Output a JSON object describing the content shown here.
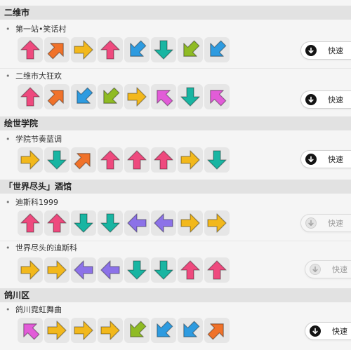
{
  "colors": {
    "pink": "#ee4a7e",
    "orange": "#f0722a",
    "yellow": "#f2b81c",
    "blue": "#2e9be0",
    "teal": "#19b5a2",
    "green": "#8fbb24",
    "purple": "#8c72e8",
    "magenta": "#e25cd8"
  },
  "sections": [
    {
      "title": "二维市",
      "songs": [
        {
          "title": "第一站•笑话村",
          "button": {
            "label": "快速",
            "icon": "down-arrow-icon",
            "enabled": true
          },
          "arrows": [
            {
              "dir": "up",
              "color": "pink"
            },
            {
              "dir": "up-right",
              "color": "orange"
            },
            {
              "dir": "right",
              "color": "yellow"
            },
            {
              "dir": "up",
              "color": "pink"
            },
            {
              "dir": "down-left",
              "color": "blue"
            },
            {
              "dir": "down",
              "color": "teal"
            },
            {
              "dir": "down-left",
              "color": "green"
            },
            {
              "dir": "down-left",
              "color": "blue"
            }
          ]
        },
        {
          "title": "二维市大狂欢",
          "button": {
            "label": "快速",
            "icon": "down-arrow-icon",
            "enabled": true
          },
          "arrows": [
            {
              "dir": "up",
              "color": "pink"
            },
            {
              "dir": "up-right",
              "color": "orange"
            },
            {
              "dir": "down-left",
              "color": "blue"
            },
            {
              "dir": "down-left",
              "color": "green"
            },
            {
              "dir": "right",
              "color": "yellow"
            },
            {
              "dir": "up-left",
              "color": "magenta"
            },
            {
              "dir": "down",
              "color": "teal"
            },
            {
              "dir": "up-left",
              "color": "magenta"
            }
          ]
        }
      ]
    },
    {
      "title": "绘世学院",
      "songs": [
        {
          "title": "学院节奏蓝调",
          "button": {
            "label": "快速",
            "icon": "down-arrow-icon",
            "enabled": true
          },
          "arrows": [
            {
              "dir": "right",
              "color": "yellow"
            },
            {
              "dir": "down",
              "color": "teal"
            },
            {
              "dir": "up-right",
              "color": "orange"
            },
            {
              "dir": "up",
              "color": "pink"
            },
            {
              "dir": "up",
              "color": "pink"
            },
            {
              "dir": "up",
              "color": "pink"
            },
            {
              "dir": "right",
              "color": "yellow"
            },
            {
              "dir": "down",
              "color": "teal"
            }
          ]
        }
      ]
    },
    {
      "title": "「世界尽头」酒馆",
      "songs": [
        {
          "title": "迪斯科1999",
          "button": {
            "label": "快速",
            "icon": "down-arrow-icon",
            "enabled": false
          },
          "arrows": [
            {
              "dir": "up",
              "color": "pink"
            },
            {
              "dir": "up",
              "color": "pink"
            },
            {
              "dir": "down",
              "color": "teal"
            },
            {
              "dir": "down",
              "color": "teal"
            },
            {
              "dir": "left",
              "color": "purple"
            },
            {
              "dir": "left",
              "color": "purple"
            },
            {
              "dir": "right",
              "color": "yellow"
            },
            {
              "dir": "right",
              "color": "yellow"
            }
          ]
        },
        {
          "title": "世界尽头的迪斯科",
          "button": {
            "label": "快速",
            "icon": "down-arrow-icon",
            "enabled": false
          },
          "arrows": [
            {
              "dir": "right",
              "color": "yellow"
            },
            {
              "dir": "right",
              "color": "yellow"
            },
            {
              "dir": "left",
              "color": "purple"
            },
            {
              "dir": "left",
              "color": "purple"
            },
            {
              "dir": "down",
              "color": "teal"
            },
            {
              "dir": "down",
              "color": "teal"
            },
            {
              "dir": "up",
              "color": "pink"
            },
            {
              "dir": "up",
              "color": "pink"
            }
          ]
        }
      ]
    },
    {
      "title": "鸽川区",
      "songs": [
        {
          "title": "鸽川霓虹舞曲",
          "button": {
            "label": "快速",
            "icon": "down-arrow-icon",
            "enabled": true
          },
          "arrows": [
            {
              "dir": "up-left",
              "color": "magenta"
            },
            {
              "dir": "right",
              "color": "yellow"
            },
            {
              "dir": "right",
              "color": "yellow"
            },
            {
              "dir": "right",
              "color": "yellow"
            },
            {
              "dir": "down-left",
              "color": "green"
            },
            {
              "dir": "down-left",
              "color": "blue"
            },
            {
              "dir": "down-left",
              "color": "blue"
            },
            {
              "dir": "up-right",
              "color": "orange"
            }
          ]
        }
      ]
    }
  ]
}
